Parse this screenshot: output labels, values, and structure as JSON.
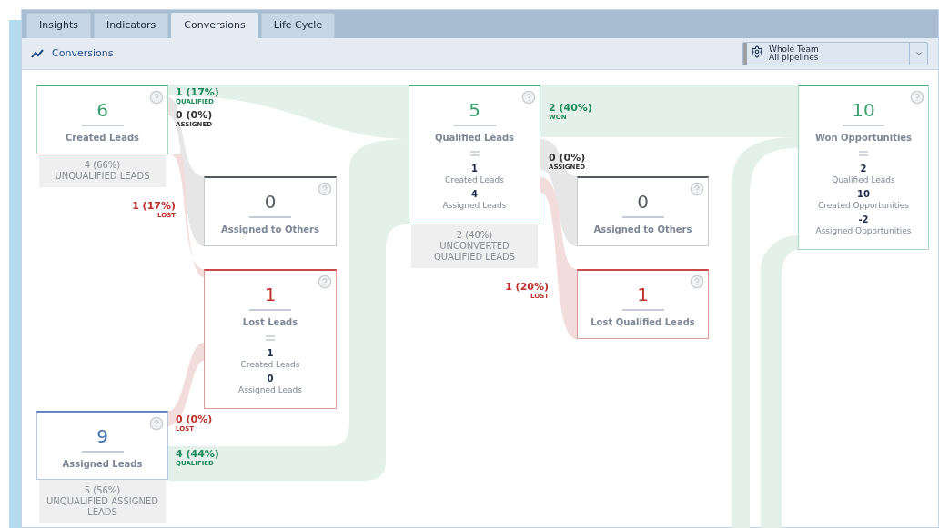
{
  "tabs": [
    {
      "label": "Insights",
      "selected": false
    },
    {
      "label": "Indicators",
      "selected": false
    },
    {
      "label": "Conversions",
      "selected": true
    },
    {
      "label": "Life Cycle",
      "selected": false
    }
  ],
  "header": {
    "title": "Conversions",
    "filter": {
      "title": "Whole Team",
      "subtitle": "All pipelines"
    }
  },
  "nodes": [
    {
      "kind": "created",
      "value": "6",
      "label": "Created Leads",
      "remainder": {
        "value": "4 (66%)",
        "label": "UNQUALIFIED LEADS"
      }
    },
    {
      "kind": "neutral",
      "value": "0",
      "label": "Assigned to Others"
    },
    {
      "kind": "lost",
      "value": "1",
      "label": "Lost Leads",
      "breakdown": [
        {
          "value": "1",
          "label": "Created Leads"
        },
        {
          "value": "0",
          "label": "Assigned Leads"
        }
      ]
    },
    {
      "kind": "assigned",
      "value": "9",
      "label": "Assigned Leads",
      "remainder": {
        "value": "5 (56%)",
        "label": "UNQUALIFIED ASSIGNED LEADS"
      }
    },
    {
      "kind": "created",
      "value": "5",
      "label": "Qualified Leads",
      "breakdown": [
        {
          "value": "1",
          "label": "Created Leads"
        },
        {
          "value": "4",
          "label": "Assigned Leads"
        }
      ],
      "remainder": {
        "value": "2 (40%)",
        "label": "UNCONVERTED QUALIFIED LEADS"
      }
    },
    {
      "kind": "neutral",
      "value": "0",
      "label": "Assigned to Others"
    },
    {
      "kind": "lost",
      "value": "1",
      "label": "Lost Qualified Leads"
    },
    {
      "kind": "created",
      "value": "10",
      "label": "Won Opportunities",
      "breakdown": [
        {
          "value": "2",
          "label": "Qualified Leads"
        },
        {
          "value": "10",
          "label": "Created Opportunities"
        },
        {
          "value": "-2",
          "label": "Assigned Opportunities"
        }
      ]
    }
  ],
  "flow_labels": [
    {
      "kind": "qualified",
      "value": "1 (17%)",
      "label": "QUALIFIED"
    },
    {
      "kind": "assigned",
      "value": "0 (0%)",
      "label": "ASSIGNED"
    },
    {
      "kind": "lost",
      "value": "1 (17%)",
      "label": "LOST"
    },
    {
      "kind": "lost",
      "value": "0 (0%)",
      "label": "LOST"
    },
    {
      "kind": "qualified",
      "value": "4 (44%)",
      "label": "QUALIFIED"
    },
    {
      "kind": "qualified",
      "value": "2 (40%)",
      "label": "WON"
    },
    {
      "kind": "assigned",
      "value": "0 (0%)",
      "label": "ASSIGNED"
    },
    {
      "kind": "lost",
      "value": "1 (20%)",
      "label": "LOST"
    }
  ]
}
